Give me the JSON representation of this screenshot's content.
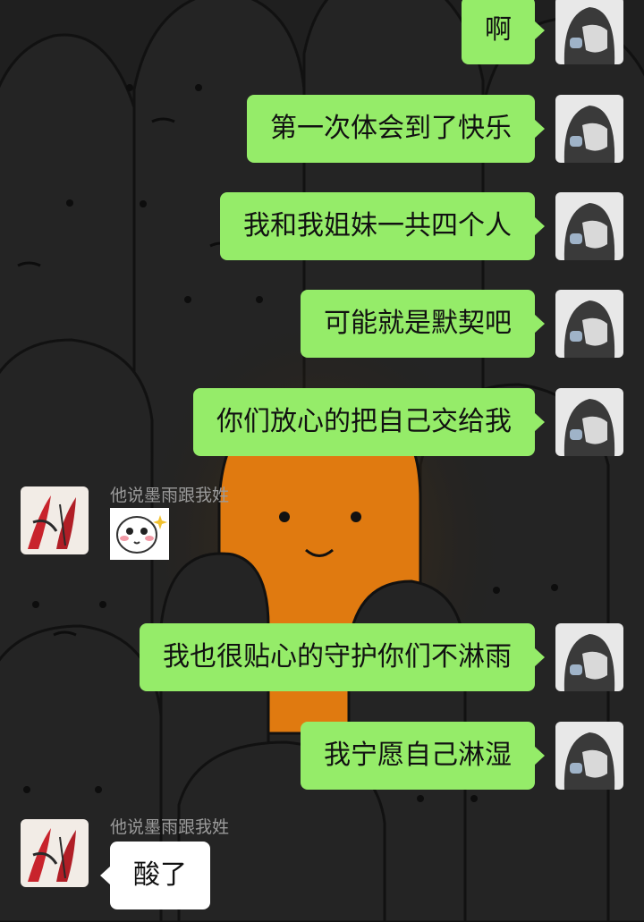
{
  "colors": {
    "bubble_sent": "#95ec69",
    "bubble_received": "#ffffff",
    "background": "#1e1e1e",
    "accent_orange": "#e07a10",
    "nickname": "#9a9a9a"
  },
  "messages": [
    {
      "sender": "me",
      "text": "啊"
    },
    {
      "sender": "me",
      "text": "第一次体会到了快乐"
    },
    {
      "sender": "me",
      "text": "我和我姐妹一共四个人"
    },
    {
      "sender": "me",
      "text": "可能就是默契吧"
    },
    {
      "sender": "me",
      "text": "你们放心的把自己交给我"
    },
    {
      "sender": "other",
      "nickname": "他说墨雨跟我姓",
      "sticker": "blushing-face-sticker"
    },
    {
      "sender": "me",
      "text": "我也很贴心的守护你们不淋雨"
    },
    {
      "sender": "me",
      "text": "我宁愿自己淋湿"
    },
    {
      "sender": "other",
      "nickname": "他说墨雨跟我姓",
      "text": "酸了"
    }
  ],
  "icons": {
    "my_avatar": "hooded-figure-avatar",
    "other_avatar": "red-flower-avatar"
  }
}
